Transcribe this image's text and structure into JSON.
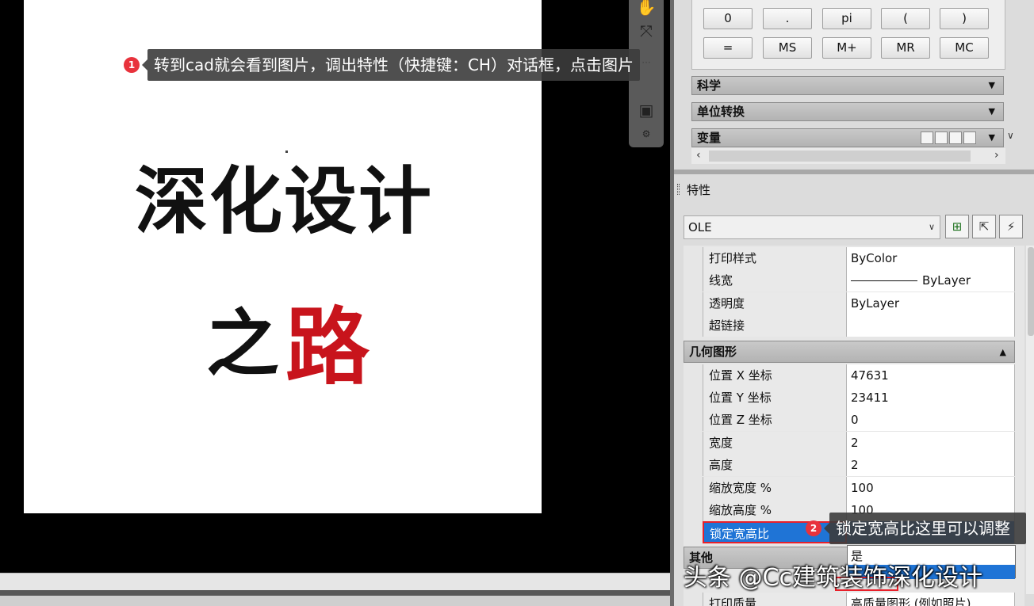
{
  "canvas": {
    "logo_line1": "深化设计",
    "logo_line2a": "之",
    "logo_line2b": "路"
  },
  "calculator": {
    "keys_row1": [
      "0",
      ".",
      "pi",
      "(",
      ")"
    ],
    "keys_row2": [
      "=",
      "MS",
      "M+",
      "MR",
      "MC"
    ],
    "sections": {
      "science": "科学",
      "unit_convert": "单位转换",
      "variables": "变量"
    }
  },
  "properties": {
    "title": "特性",
    "object_type": "OLE",
    "rows_general": [
      {
        "name": "打印样式",
        "value": "ByColor"
      },
      {
        "name": "线宽",
        "value": "ByLayer"
      },
      {
        "name": "透明度",
        "value": "ByLayer"
      },
      {
        "name": "超链接",
        "value": ""
      }
    ],
    "category_geometry": "几何图形",
    "rows_geometry": [
      {
        "name": "位置 X 坐标",
        "value": "47631"
      },
      {
        "name": "位置 Y 坐标",
        "value": "23411"
      },
      {
        "name": "位置 Z 坐标",
        "value": "0"
      },
      {
        "name": "宽度",
        "value": "2"
      },
      {
        "name": "高度",
        "value": "2"
      },
      {
        "name": "缩放宽度 %",
        "value": "100"
      },
      {
        "name": "缩放高度 %",
        "value": "100"
      }
    ],
    "lock_row_name": "锁定宽高比",
    "dropdown_options": [
      "是",
      ""
    ],
    "category_other": "其他",
    "print_quality_name": "打印质量",
    "print_quality_value": "高质量图形 (例如照片)"
  },
  "annotations": {
    "badge1": "1",
    "callout1": "转到cad就会看到图片，调出特性（快捷键：CH）对话框，点击图片",
    "badge2": "2",
    "callout2": "锁定宽高比这里可以调整"
  },
  "watermark": "头条 @Cc建筑装饰深化设计",
  "colors": {
    "accent_red": "#c8141c",
    "selection_blue": "#1f74d6",
    "highlight_box": "#e8202a",
    "badge": "#e8323c"
  }
}
